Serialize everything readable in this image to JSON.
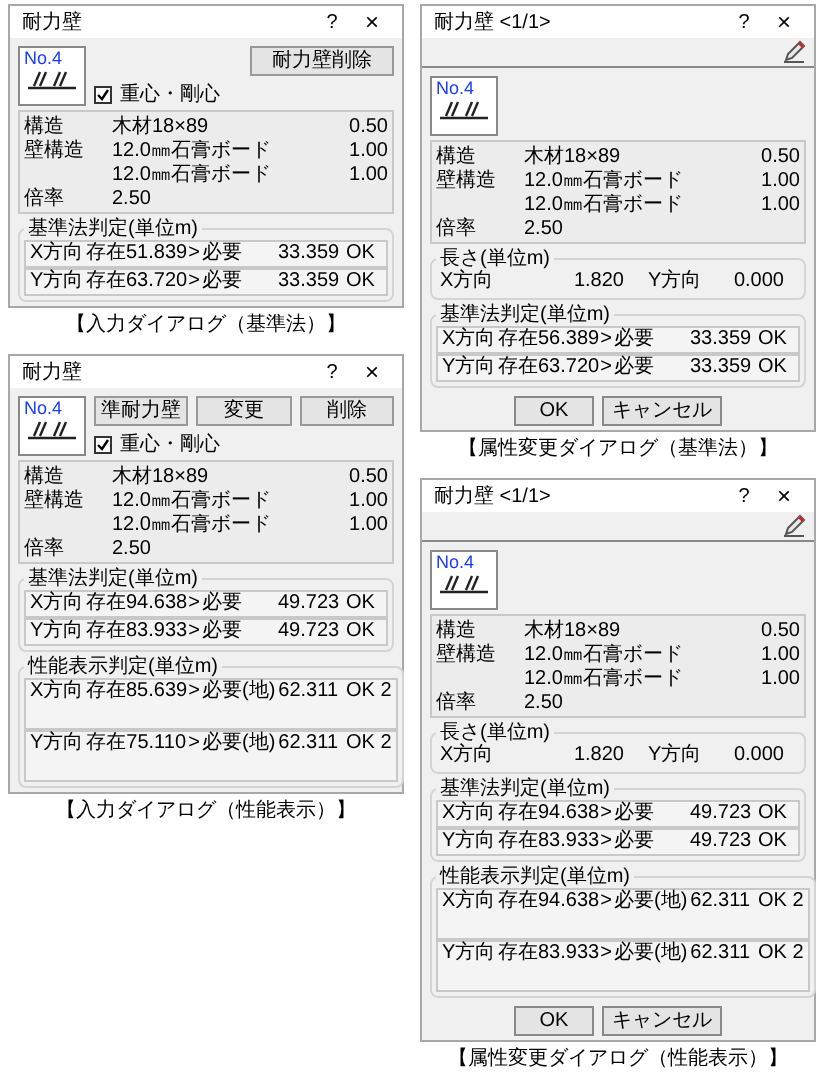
{
  "columns": [
    {
      "dialogs": [
        {
          "kind": "input",
          "title": "耐力壁",
          "help": "?",
          "close": "×",
          "thumbnail_label": "No.4",
          "top_buttons": [
            "耐力壁削除"
          ],
          "checkbox": {
            "label": "重心・剛心",
            "checked": true
          },
          "specs": [
            {
              "label": "構造",
              "value": "木材18×89",
              "factor": "0.50"
            },
            {
              "label": "壁構造",
              "value": "12.0㎜石膏ボード",
              "factor": "1.00"
            },
            {
              "value": "12.0㎜石膏ボード",
              "factor": "1.00"
            },
            {
              "label": "倍率",
              "value": "2.50"
            }
          ],
          "groups": [
            {
              "kind": "basic",
              "title": "基準法判定(単位m)",
              "rows": [
                {
                  "direction": "X方向",
                  "exist_label": "存在",
                  "exist_value": "51.839",
                  "op": ">",
                  "need_label": "必要",
                  "need_value": "33.359",
                  "result": "OK"
                },
                {
                  "direction": "Y方向",
                  "exist_label": "存在",
                  "exist_value": "63.720",
                  "op": ">",
                  "need_label": "必要",
                  "need_value": "33.359",
                  "result": "OK"
                }
              ]
            }
          ],
          "caption": "【入力ダイアログ（基準法）】"
        },
        {
          "kind": "input",
          "title": "耐力壁",
          "help": "?",
          "close": "×",
          "thumbnail_label": "No.4",
          "top_buttons": [
            "準耐力壁",
            "変更",
            "削除"
          ],
          "checkbox": {
            "label": "重心・剛心",
            "checked": true
          },
          "specs": [
            {
              "label": "構造",
              "value": "木材18×89",
              "factor": "0.50"
            },
            {
              "label": "壁構造",
              "value": "12.0㎜石膏ボード",
              "factor": "1.00"
            },
            {
              "value": "12.0㎜石膏ボード",
              "factor": "1.00"
            },
            {
              "label": "倍率",
              "value": "2.50"
            }
          ],
          "groups": [
            {
              "kind": "basic",
              "title": "基準法判定(単位m)",
              "rows": [
                {
                  "direction": "X方向",
                  "exist_label": "存在",
                  "exist_value": "94.638",
                  "op": ">",
                  "need_label": "必要",
                  "need_value": "49.723",
                  "result": "OK"
                },
                {
                  "direction": "Y方向",
                  "exist_label": "存在",
                  "exist_value": "83.933",
                  "op": ">",
                  "need_label": "必要",
                  "need_value": "49.723",
                  "result": "OK"
                }
              ]
            },
            {
              "kind": "performance",
              "title": "性能表示判定(単位m)",
              "rows": [
                {
                  "direction": "X方向",
                  "exist_label": "存在",
                  "exist_value": "85.639",
                  "op": ">",
                  "need_label": "必要(地)",
                  "need_value": "62.311",
                  "result": "OK 2"
                },
                {
                  "direction": "Y方向",
                  "exist_label": "存在",
                  "exist_value": "75.110",
                  "op": ">",
                  "need_label": "必要(地)",
                  "need_value": "62.311",
                  "result": "OK 2"
                }
              ]
            }
          ],
          "caption": "【入力ダイアログ（性能表示）】"
        }
      ]
    },
    {
      "dialogs": [
        {
          "kind": "attribute",
          "title": "耐力壁 <1/1>",
          "help": "?",
          "close": "×",
          "thumbnail_label": "No.4",
          "specs": [
            {
              "label": "構造",
              "value": "木材18×89",
              "factor": "0.50"
            },
            {
              "label": "壁構造",
              "value": "12.0㎜石膏ボード",
              "factor": "1.00"
            },
            {
              "value": "12.0㎜石膏ボード",
              "factor": "1.00"
            },
            {
              "label": "倍率",
              "value": "2.50"
            }
          ],
          "length": {
            "title": "長さ(単位m)",
            "x_label": "X方向",
            "x_value": "1.820",
            "y_label": "Y方向",
            "y_value": "0.000"
          },
          "groups": [
            {
              "kind": "basic",
              "title": "基準法判定(単位m)",
              "rows": [
                {
                  "direction": "X方向",
                  "exist_label": "存在",
                  "exist_value": "56.389",
                  "op": ">",
                  "need_label": "必要",
                  "need_value": "33.359",
                  "result": "OK"
                },
                {
                  "direction": "Y方向",
                  "exist_label": "存在",
                  "exist_value": "63.720",
                  "op": ">",
                  "need_label": "必要",
                  "need_value": "33.359",
                  "result": "OK"
                }
              ]
            }
          ],
          "footer_buttons": [
            "OK",
            "キャンセル"
          ],
          "caption": "【属性変更ダイアログ（基準法）】"
        },
        {
          "kind": "attribute",
          "title": "耐力壁 <1/1>",
          "help": "?",
          "close": "×",
          "thumbnail_label": "No.4",
          "specs": [
            {
              "label": "構造",
              "value": "木材18×89",
              "factor": "0.50"
            },
            {
              "label": "壁構造",
              "value": "12.0㎜石膏ボード",
              "factor": "1.00"
            },
            {
              "value": "12.0㎜石膏ボード",
              "factor": "1.00"
            },
            {
              "label": "倍率",
              "value": "2.50"
            }
          ],
          "length": {
            "title": "長さ(単位m)",
            "x_label": "X方向",
            "x_value": "1.820",
            "y_label": "Y方向",
            "y_value": "0.000"
          },
          "groups": [
            {
              "kind": "basic",
              "title": "基準法判定(単位m)",
              "rows": [
                {
                  "direction": "X方向",
                  "exist_label": "存在",
                  "exist_value": "94.638",
                  "op": ">",
                  "need_label": "必要",
                  "need_value": "49.723",
                  "result": "OK"
                },
                {
                  "direction": "Y方向",
                  "exist_label": "存在",
                  "exist_value": "83.933",
                  "op": ">",
                  "need_label": "必要",
                  "need_value": "49.723",
                  "result": "OK"
                }
              ]
            },
            {
              "kind": "performance",
              "title": "性能表示判定(単位m)",
              "rows": [
                {
                  "direction": "X方向",
                  "exist_label": "存在",
                  "exist_value": "94.638",
                  "op": ">",
                  "need_label": "必要(地)",
                  "need_value": "62.311",
                  "result": "OK 2"
                },
                {
                  "direction": "Y方向",
                  "exist_label": "存在",
                  "exist_value": "83.933",
                  "op": ">",
                  "need_label": "必要(地)",
                  "need_value": "62.311",
                  "result": "OK 2"
                }
              ]
            }
          ],
          "footer_buttons": [
            "OK",
            "キャンセル"
          ],
          "caption": "【属性変更ダイアログ（性能表示）】"
        }
      ]
    }
  ]
}
